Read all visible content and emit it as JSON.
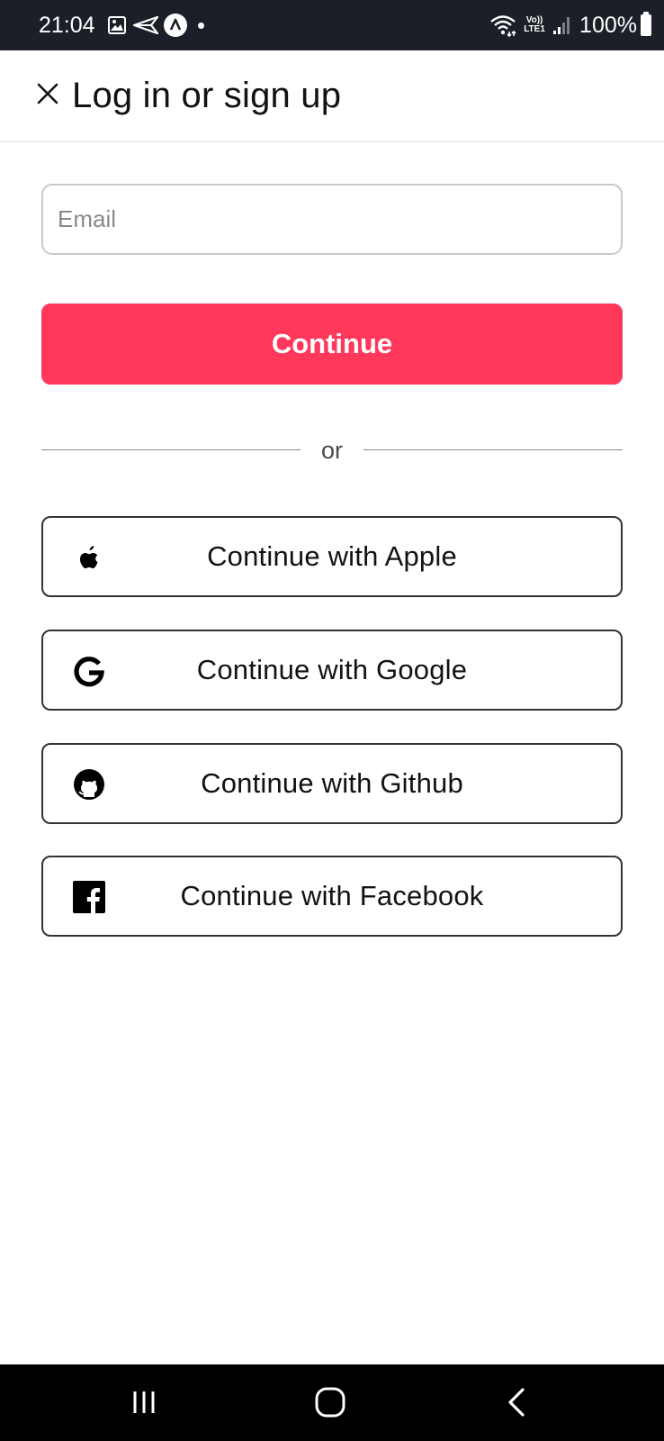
{
  "status_bar": {
    "time": "21:04",
    "network_label_top": "Vo))",
    "network_label_bottom": "LTE1",
    "battery_text": "100%",
    "icons": [
      "image-icon",
      "send-icon",
      "app-a-icon",
      "dot-icon",
      "wifi-icon",
      "signal-icon",
      "battery-icon"
    ]
  },
  "header": {
    "title": "Log in or sign up",
    "close_icon": "close-icon"
  },
  "form": {
    "email_placeholder": "Email",
    "email_value": "",
    "continue_label": "Continue",
    "divider_text": "or"
  },
  "social": [
    {
      "icon": "apple-icon",
      "label": "Continue with Apple"
    },
    {
      "icon": "google-icon",
      "label": "Continue with Google"
    },
    {
      "icon": "github-icon",
      "label": "Continue with Github"
    },
    {
      "icon": "facebook-icon",
      "label": "Continue with Facebook"
    }
  ],
  "nav_bar": {
    "icons": [
      "recents-icon",
      "home-icon",
      "back-icon"
    ]
  },
  "colors": {
    "accent": "#ff385c",
    "status_bar_bg": "#1b1f27",
    "nav_bar_bg": "#000000",
    "button_border": "#333333"
  }
}
